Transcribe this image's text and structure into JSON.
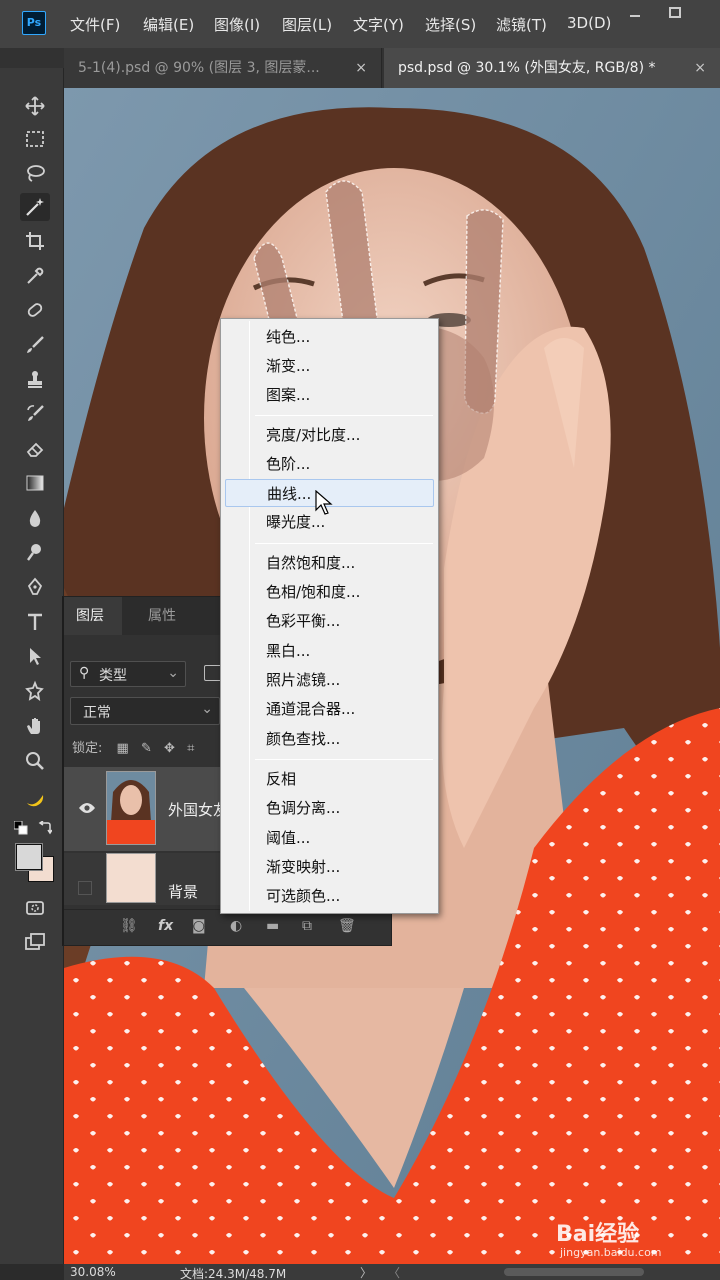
{
  "app": {
    "logo_text": "Ps"
  },
  "menubar": {
    "items": [
      "文件(F)",
      "编辑(E)",
      "图像(I)",
      "图层(L)",
      "文字(Y)",
      "选择(S)",
      "滤镜(T)",
      "3D(D)"
    ],
    "window_buttons": [
      "minimize-icon",
      "maximize-icon"
    ]
  },
  "tabs": [
    {
      "label": "5-1(4).psd @ 90% (图层 3, 图层蒙...",
      "close": "×",
      "active": false
    },
    {
      "label": "psd.psd @ 30.1% (外国女友, RGB/8) *",
      "close": "×",
      "active": true
    }
  ],
  "toolbar": {
    "tools": [
      "move-icon",
      "marquee-icon",
      "lasso-icon",
      "magic-wand-icon",
      "crop-icon",
      "eyedropper-icon",
      "healing-icon",
      "brush-icon",
      "stamp-icon",
      "history-brush-icon",
      "eraser-icon",
      "gradient-icon",
      "blur-icon",
      "dodge-icon",
      "pen-icon",
      "type-icon",
      "path-select-icon",
      "shape-icon",
      "hand-icon",
      "zoom-icon",
      "banana-icon"
    ],
    "active_tool": "magic-wand-icon",
    "foreground_color": "#d8d8d8",
    "background_color": "#f2ddd0"
  },
  "layers_panel": {
    "tabs": [
      "图层",
      "属性"
    ],
    "filter_label": "类型",
    "filter_icon": "search-icon",
    "blend_mode": "正常",
    "lock_label": "锁定:",
    "layers": [
      {
        "name": "外国女友",
        "visible": true,
        "selected": true
      },
      {
        "name": "背景",
        "visible": false,
        "selected": false
      }
    ],
    "footer_icons": [
      "link-icon",
      "fx-icon",
      "mask-icon",
      "adjustment-icon",
      "group-icon",
      "new-layer-icon",
      "trash-icon"
    ]
  },
  "context_menu": {
    "groups": [
      [
        "纯色...",
        "渐变...",
        "图案..."
      ],
      [
        "亮度/对比度...",
        "色阶...",
        "曲线...",
        "曝光度..."
      ],
      [
        "自然饱和度...",
        "色相/饱和度...",
        "色彩平衡...",
        "黑白...",
        "照片滤镜...",
        "通道混合器...",
        "颜色查找..."
      ],
      [
        "反相",
        "色调分离...",
        "阈值...",
        "渐变映射...",
        "可选颜色..."
      ]
    ],
    "hovered": "曲线..."
  },
  "statusbar": {
    "zoom": "30.08%",
    "doc_info": "文档:24.3M/48.7M",
    "arrow": "〉",
    "scroll_left": "〈"
  },
  "watermark": {
    "main": "Bai经验",
    "sub": "jingyan.baidu.com"
  }
}
